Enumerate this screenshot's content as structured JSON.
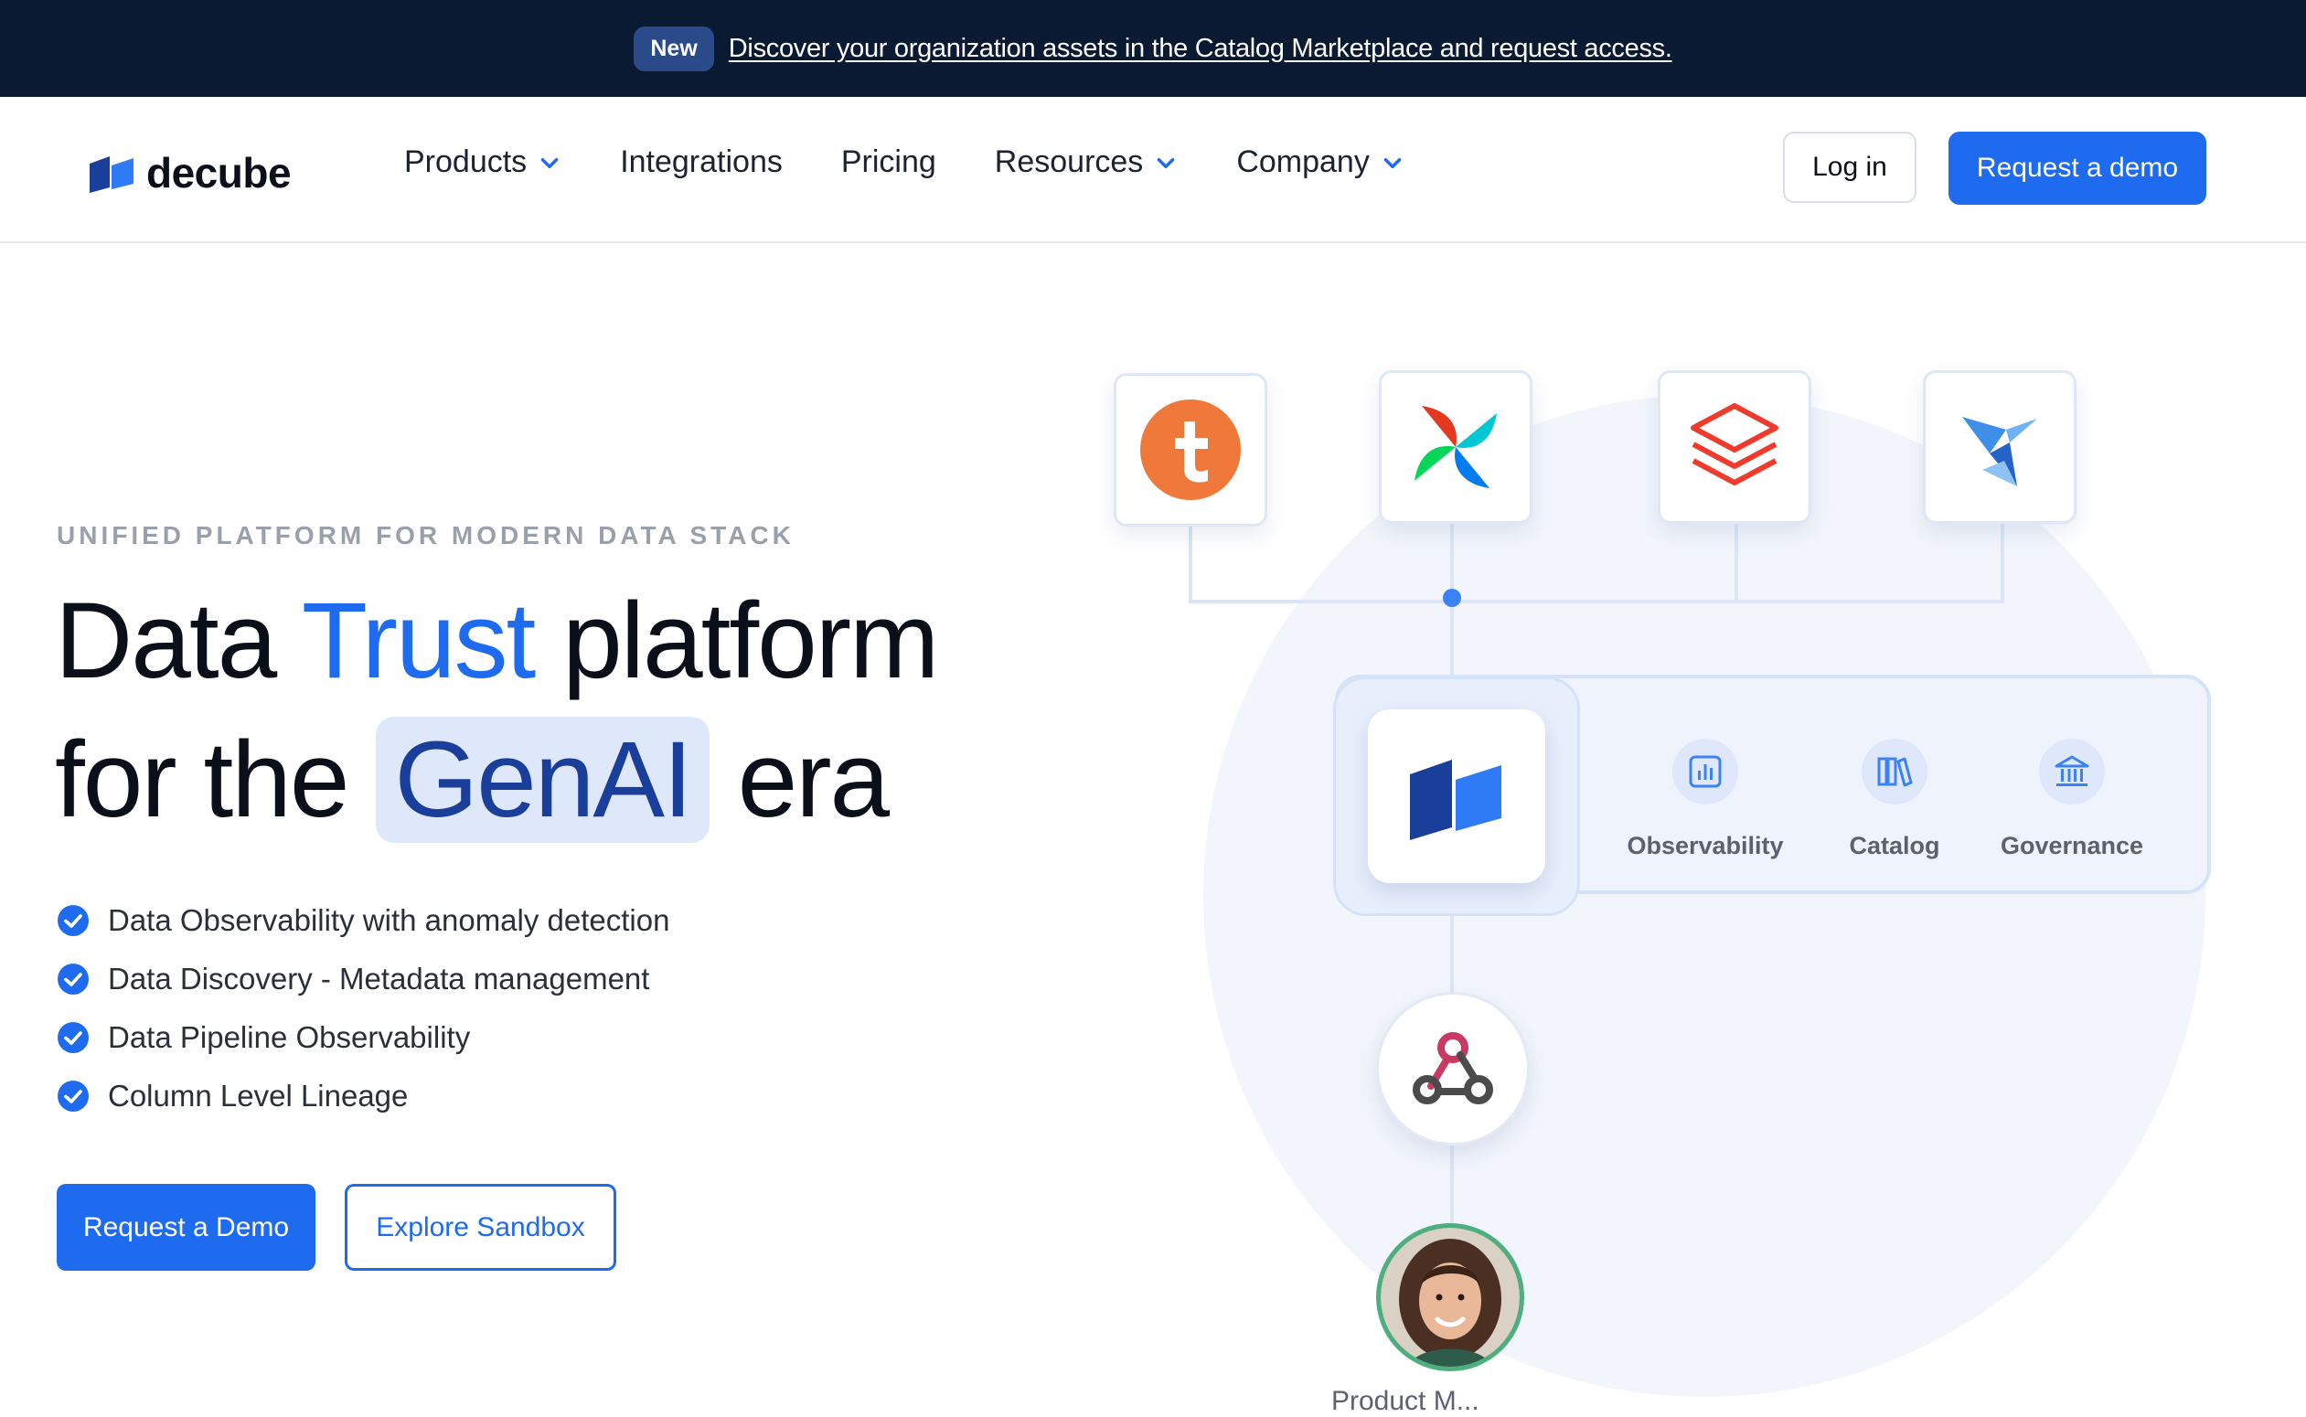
{
  "announcement": {
    "badge": "New",
    "link_text": "Discover your organization assets in the Catalog Marketplace and request access."
  },
  "nav": {
    "logo_text": "decube",
    "items": [
      {
        "label": "Products",
        "has_dropdown": true
      },
      {
        "label": "Integrations",
        "has_dropdown": false
      },
      {
        "label": "Pricing",
        "has_dropdown": false
      },
      {
        "label": "Resources",
        "has_dropdown": true
      },
      {
        "label": "Company",
        "has_dropdown": true
      }
    ],
    "login_label": "Log in",
    "demo_label": "Request a demo"
  },
  "hero": {
    "eyebrow": "UNIFIED PLATFORM FOR MODERN DATA STACK",
    "headline": {
      "part1": "Data ",
      "highlight1": "Trust",
      "part2": " platform",
      "part3": "for the ",
      "highlight2": "GenAI",
      "part4": " era"
    },
    "features": [
      "Data Observability with anomaly detection",
      "Data Discovery - Metadata management",
      "Data Pipeline Observability",
      "Column Level Lineage"
    ],
    "primary_cta": "Request a Demo",
    "secondary_cta": "Explore Sandbox"
  },
  "illustration": {
    "tools": [
      "talend-icon",
      "airflow-icon",
      "databricks-icon",
      "fivetran-icon"
    ],
    "platform_features": [
      {
        "label": "Observability",
        "icon": "chart-icon"
      },
      {
        "label": "Catalog",
        "icon": "books-icon"
      },
      {
        "label": "Governance",
        "icon": "bank-icon"
      }
    ],
    "webhook_icon": "webhook-icon",
    "avatar_caption": "Product M..."
  },
  "colors": {
    "brand_blue": "#1f6bf0",
    "dark_navy": "#0b1a33",
    "genai_text": "#1a3f9b",
    "genai_bg": "#dfe8fb"
  }
}
